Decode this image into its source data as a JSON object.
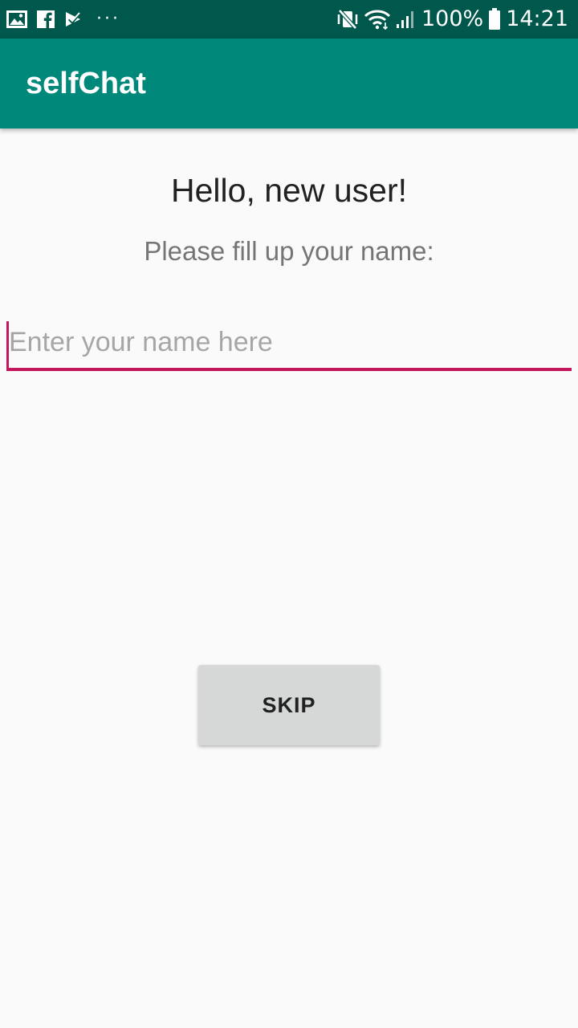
{
  "status_bar": {
    "left_icons": [
      "gallery-icon",
      "facebook-icon",
      "check-notification-icon"
    ],
    "more_dots": "···",
    "right_icons": [
      "mute-vibrate-icon",
      "wifi-icon",
      "signal-icon",
      "battery-icon"
    ],
    "battery_percent": "100%",
    "time": "14:21"
  },
  "app_bar": {
    "title": "selfChat"
  },
  "main": {
    "greeting": "Hello, new user!",
    "instruction": "Please fill up your name:",
    "name_input": {
      "placeholder": "Enter your name here",
      "value": ""
    },
    "skip_label": "SKIP"
  },
  "colors": {
    "status_bar": "#00574b",
    "app_bar": "#00897b",
    "accent": "#c2185b",
    "background": "#fafafa",
    "button": "#d6d7d7"
  }
}
